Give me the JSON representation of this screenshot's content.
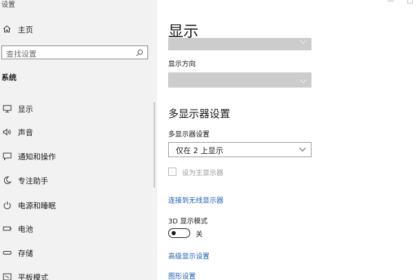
{
  "window": {
    "app_title": "设置",
    "minimize": "—",
    "maximize": "□"
  },
  "sidebar": {
    "home_label": "主页",
    "search": {
      "placeholder": "查找设置"
    },
    "section_title": "系统",
    "items": [
      {
        "label": "显示",
        "icon": "monitor-icon"
      },
      {
        "label": "声音",
        "icon": "speaker-icon"
      },
      {
        "label": "通知和操作",
        "icon": "notification-icon"
      },
      {
        "label": "专注助手",
        "icon": "moon-icon"
      },
      {
        "label": "电源和睡眠",
        "icon": "power-icon"
      },
      {
        "label": "电池",
        "icon": "battery-icon"
      },
      {
        "label": "存储",
        "icon": "storage-icon"
      },
      {
        "label": "平板模式",
        "icon": "tablet-icon"
      }
    ]
  },
  "main": {
    "page_title": "显示",
    "orientation_label": "显示方向",
    "multi_display_heading": "多显示器设置",
    "multi_display_label": "多显示器设置",
    "multi_display_value": "仅在 2 上显示",
    "primary_checkbox_label": "设为主显示器",
    "wireless_link": "连接到无线显示器",
    "mode_3d_label": "3D 显示模式",
    "mode_3d_state": "关",
    "mode_3d_on": false,
    "advanced_link": "高级显示设置",
    "graphics_link": "图形设置"
  },
  "colors": {
    "accent": "#1f5fb5",
    "sidebar_bg": "#f2f2f2",
    "disabled_combo": "#cccccc"
  }
}
